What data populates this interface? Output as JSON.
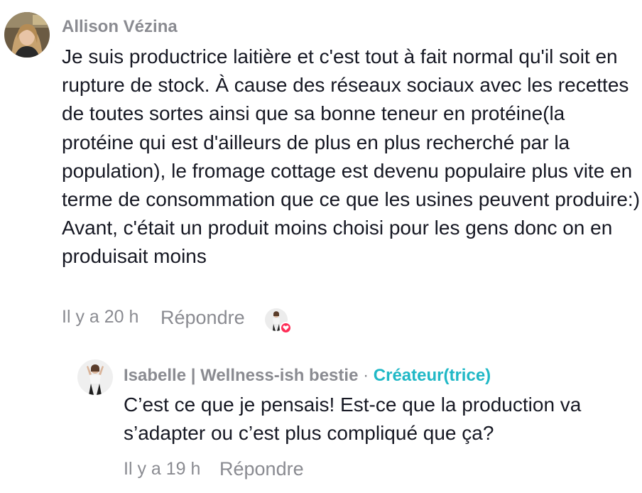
{
  "comment": {
    "username": "Allison Vézina",
    "text": "Je suis productrice laitière et c'est tout à fait normal qu'il soit en rupture de stock. À cause des réseaux sociaux avec les recettes de toutes sortes ainsi que sa bonne teneur en protéine(la protéine qui est d'ailleurs de plus en plus recherché par la population), le fromage cottage est devenu populaire plus vite en terme de consommation que ce que les usines peuvent produire:) Avant, c'était un produit moins choisi pour les gens donc on en produisait moins",
    "time": "Il y a 20 h",
    "reply_label": "Répondre",
    "avatar_icon": "user-photo-avatar",
    "liked_by_creator": true,
    "heart_icon": "heart-icon",
    "heart_color": "#fe2c55"
  },
  "reply": {
    "username": "Isabelle | Wellness-ish bestie",
    "separator": "·",
    "creator_badge": "Créateur(trice)",
    "creator_color": "#20b8c6",
    "text": "C’est ce que je pensais! Est-ce que la production va s’adapter ou c’est plus compliqué que ça?",
    "time": "Il y a 19 h",
    "reply_label": "Répondre",
    "avatar_icon": "creator-photo-avatar"
  },
  "colors": {
    "text_primary": "#161823",
    "text_secondary": "#8a8b91",
    "background": "#ffffff"
  }
}
